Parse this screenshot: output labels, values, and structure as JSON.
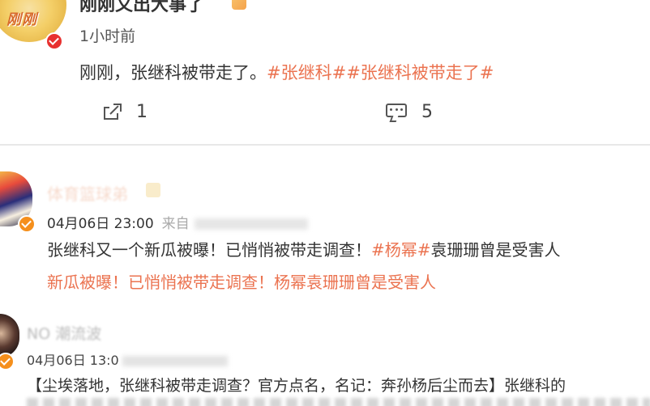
{
  "posts": [
    {
      "author": "刚刚又出大事了",
      "avatar_text": "刚刚",
      "time": "1小时前",
      "content_text": "刚刚，张继科被带走了。",
      "tags": [
        "#张继科#",
        "#张继科被带走了#"
      ],
      "share_count": "1",
      "comment_count": "5",
      "icons": {
        "share": "share-icon",
        "comment": "comment-icon",
        "verified": "verified-badge-icon"
      }
    },
    {
      "author": "体育篮球弟",
      "time": "04月06日 23:00",
      "source": "来自",
      "content_line1_prefix": "张继科又一个新瓜被曝！已悄悄被带走调查！",
      "content_line1_tag": "#杨幂#",
      "content_line1_suffix": "袁珊珊曾是受害人",
      "content_line2": "新瓜被曝！已悄悄被带走调查！杨幂袁珊珊曾是受害人"
    },
    {
      "author": "NO 潮流波",
      "time": "04月06日 13:0",
      "content": "【尘埃落地，张继科被带走调查？官方点名，名记：奔孙杨后尘而去】张继科的"
    }
  ],
  "colors": {
    "tag": "#eb7350",
    "verify_orange": "#f58f1c",
    "verify_red": "#e8302f",
    "divider": "#e8e8e8"
  }
}
